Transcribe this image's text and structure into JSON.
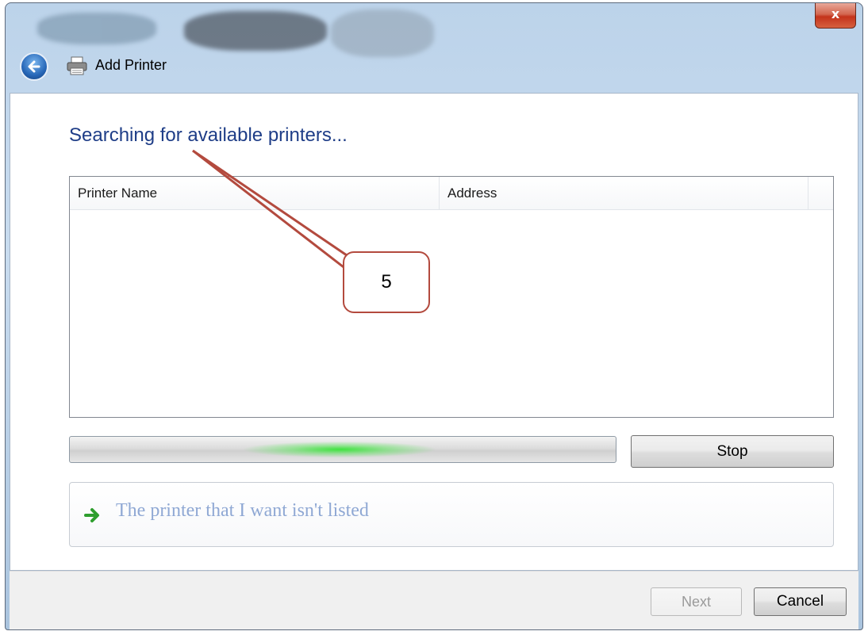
{
  "window": {
    "title": "Add Printer",
    "close_label": "x"
  },
  "page": {
    "heading": "Searching for available printers..."
  },
  "printer_list": {
    "columns": [
      "Printer Name",
      "Address"
    ],
    "rows": []
  },
  "progress": {
    "state": "marquee-indeterminate"
  },
  "buttons": {
    "stop_label": "Stop",
    "next_label": "Next",
    "cancel_label": "Cancel"
  },
  "link": {
    "label": "The printer that I want isn't listed"
  },
  "annotation": {
    "callout_label": "5"
  },
  "icons": {
    "back": "back-arrow-icon",
    "printer": "printer-icon",
    "link_arrow": "green-arrow-icon",
    "close": "close-icon"
  },
  "colors": {
    "heading": "#1e3d87",
    "link_text": "#8fa8d4",
    "close_button": "#c4331b",
    "callout_border": "#b34a3e",
    "progress_glow": "#3fe33f"
  }
}
